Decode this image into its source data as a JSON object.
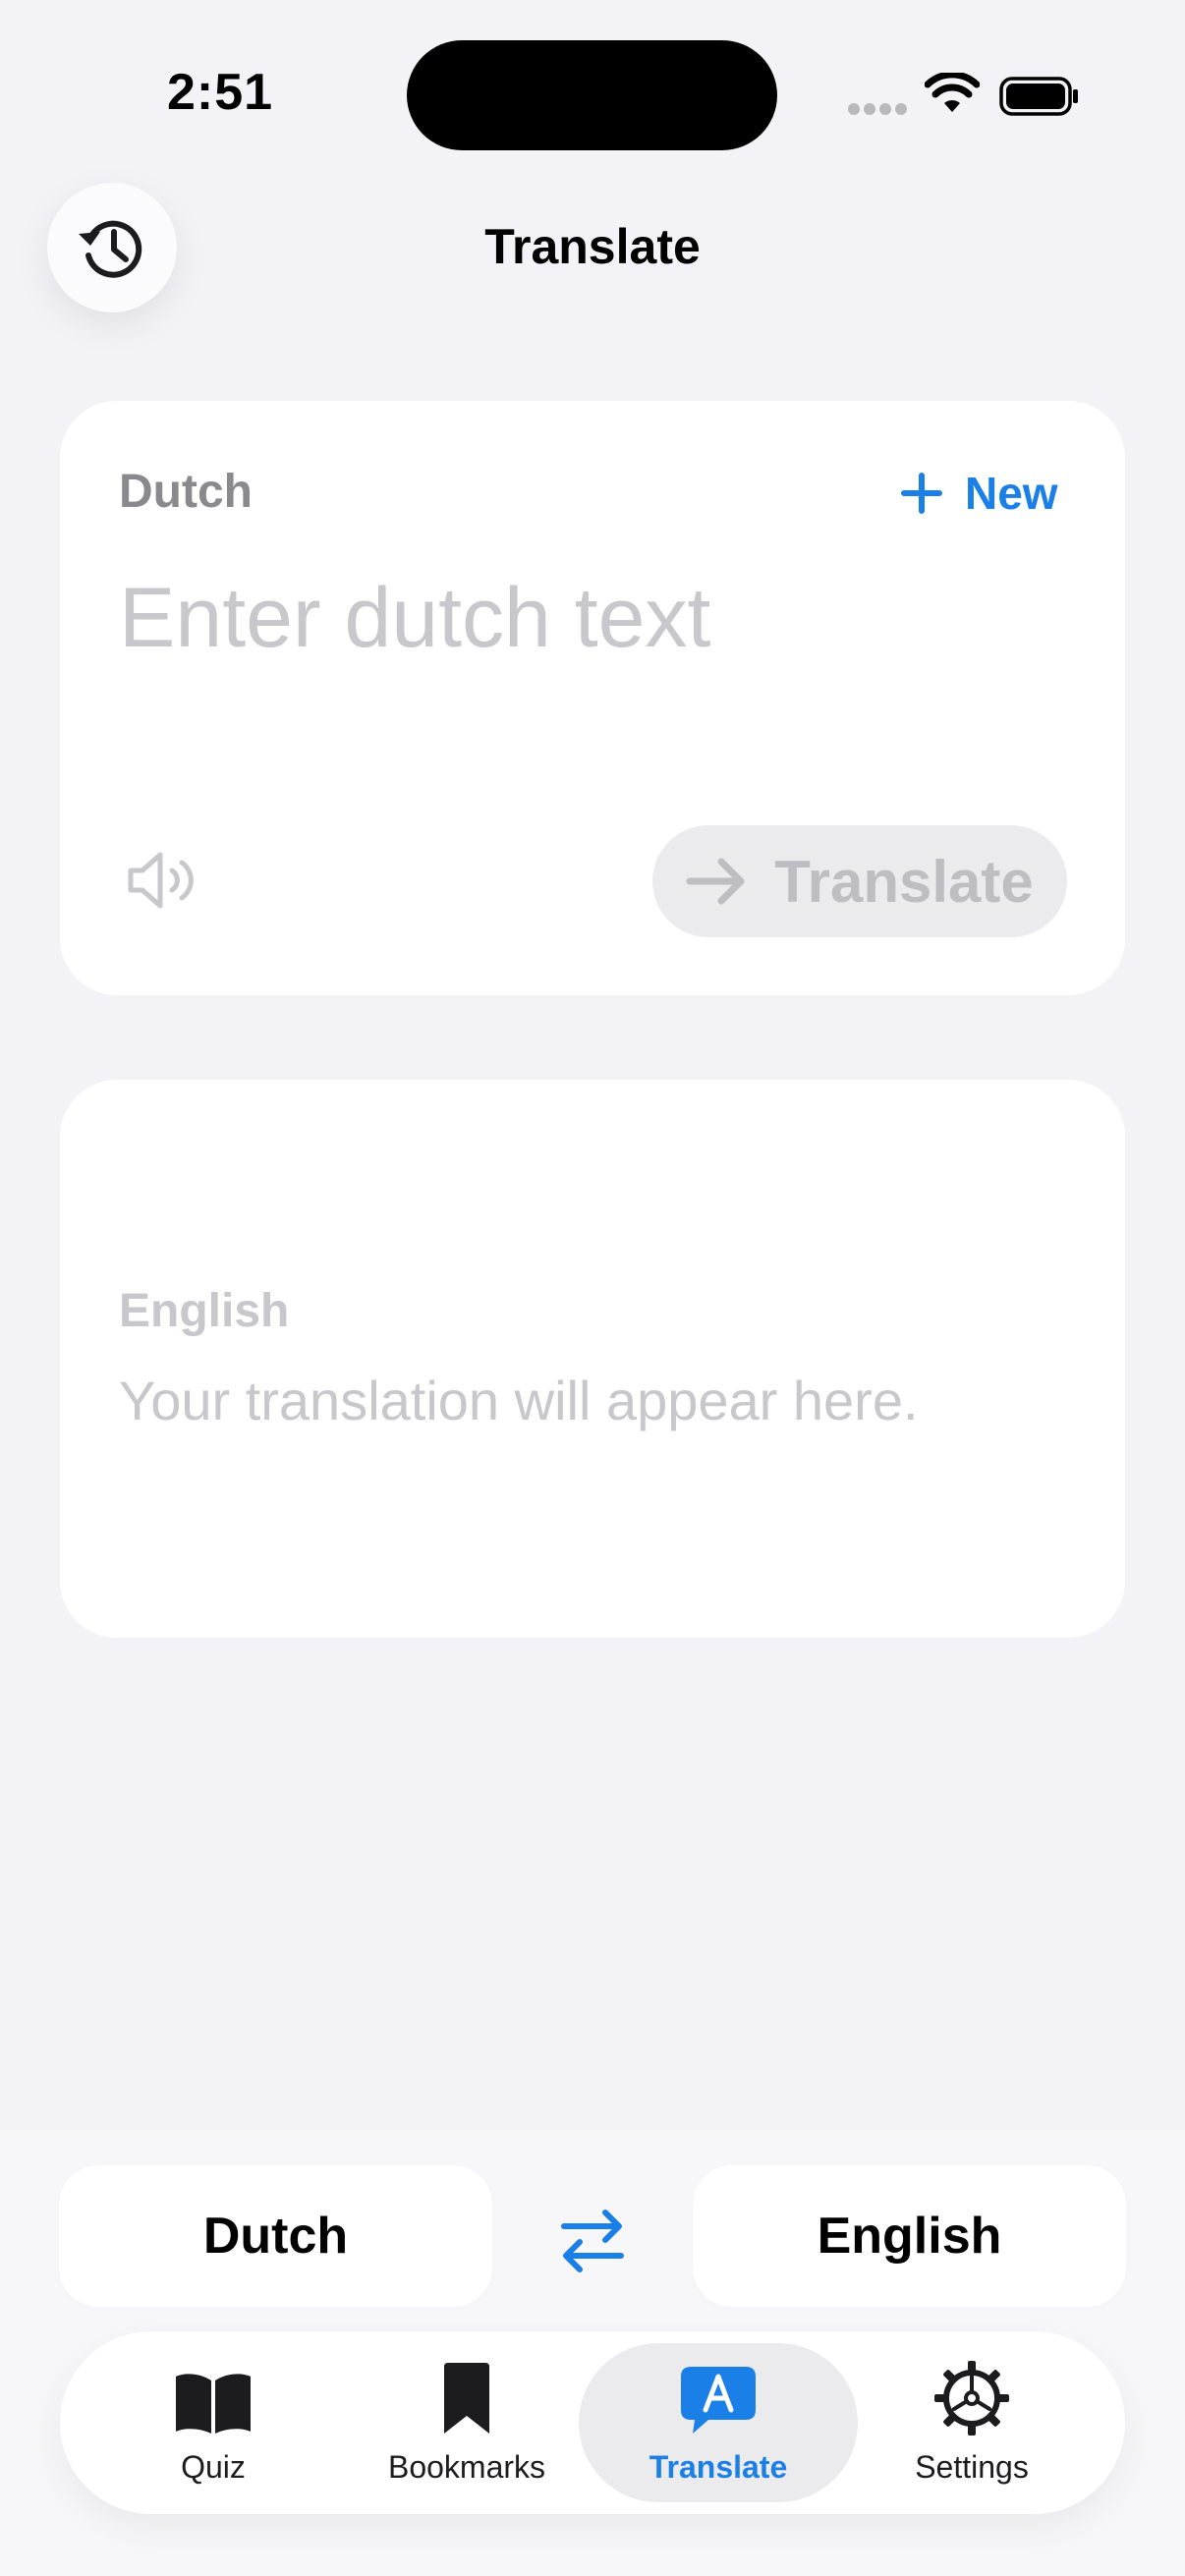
{
  "status_bar": {
    "time": "2:51"
  },
  "header": {
    "title": "Translate",
    "history_icon": "history-icon"
  },
  "source_card": {
    "language_label": "Dutch",
    "new_label": "New",
    "input_placeholder": "Enter dutch text",
    "input_value": "",
    "translate_label": "Translate"
  },
  "result_card": {
    "language_label": "English",
    "placeholder_text": "Your translation will appear here."
  },
  "language_bar": {
    "from": "Dutch",
    "to": "English"
  },
  "tabbar": {
    "items": [
      {
        "label": "Quiz",
        "icon": "book-icon"
      },
      {
        "label": "Bookmarks",
        "icon": "bookmark-icon"
      },
      {
        "label": "Translate",
        "icon": "translate-bubble-icon"
      },
      {
        "label": "Settings",
        "icon": "gear-icon"
      }
    ],
    "active": "Translate"
  },
  "colors": {
    "accent": "#1a7fe6",
    "background": "#f2f2f7",
    "card": "#ffffff",
    "muted_text": "#c7c7cc",
    "label_gray": "#8a8a8e"
  }
}
